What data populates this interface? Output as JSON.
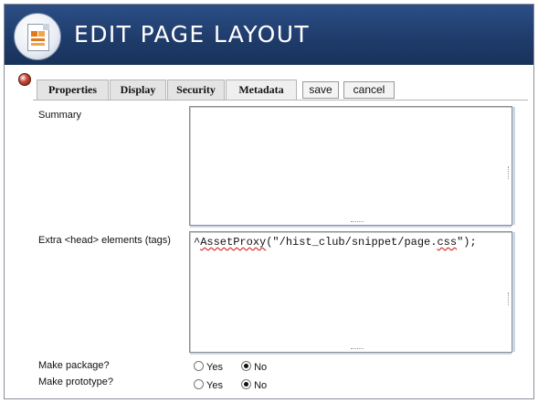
{
  "window": {
    "title": "EDIT PAGE LAYOUT",
    "icon": "page-layout-icon"
  },
  "tabs": [
    {
      "label": "Properties"
    },
    {
      "label": "Display"
    },
    {
      "label": "Security"
    },
    {
      "label": "Metadata"
    }
  ],
  "toolbar": {
    "save_label": "save",
    "cancel_label": "cancel"
  },
  "form": {
    "summary_label": "Summary",
    "summary_value": "",
    "extra_head_label": "Extra <head> elements (tags)",
    "extra_head_value_prefix": "^",
    "extra_head_value_fn": "AssetProxy",
    "extra_head_value_rest": "(\"/hist_club/snippet/page.",
    "extra_head_value_ext": "css",
    "extra_head_value_end": "\");",
    "make_package_label": "Make package?",
    "make_prototype_label": "Make prototype?",
    "yes_label": "Yes",
    "no_label": "No",
    "make_package_value": "No",
    "make_prototype_value": "No"
  },
  "colors": {
    "titlebar": "#1f3c6c",
    "title_text": "#ffffff",
    "tab_bg": "#e4e4e4"
  }
}
